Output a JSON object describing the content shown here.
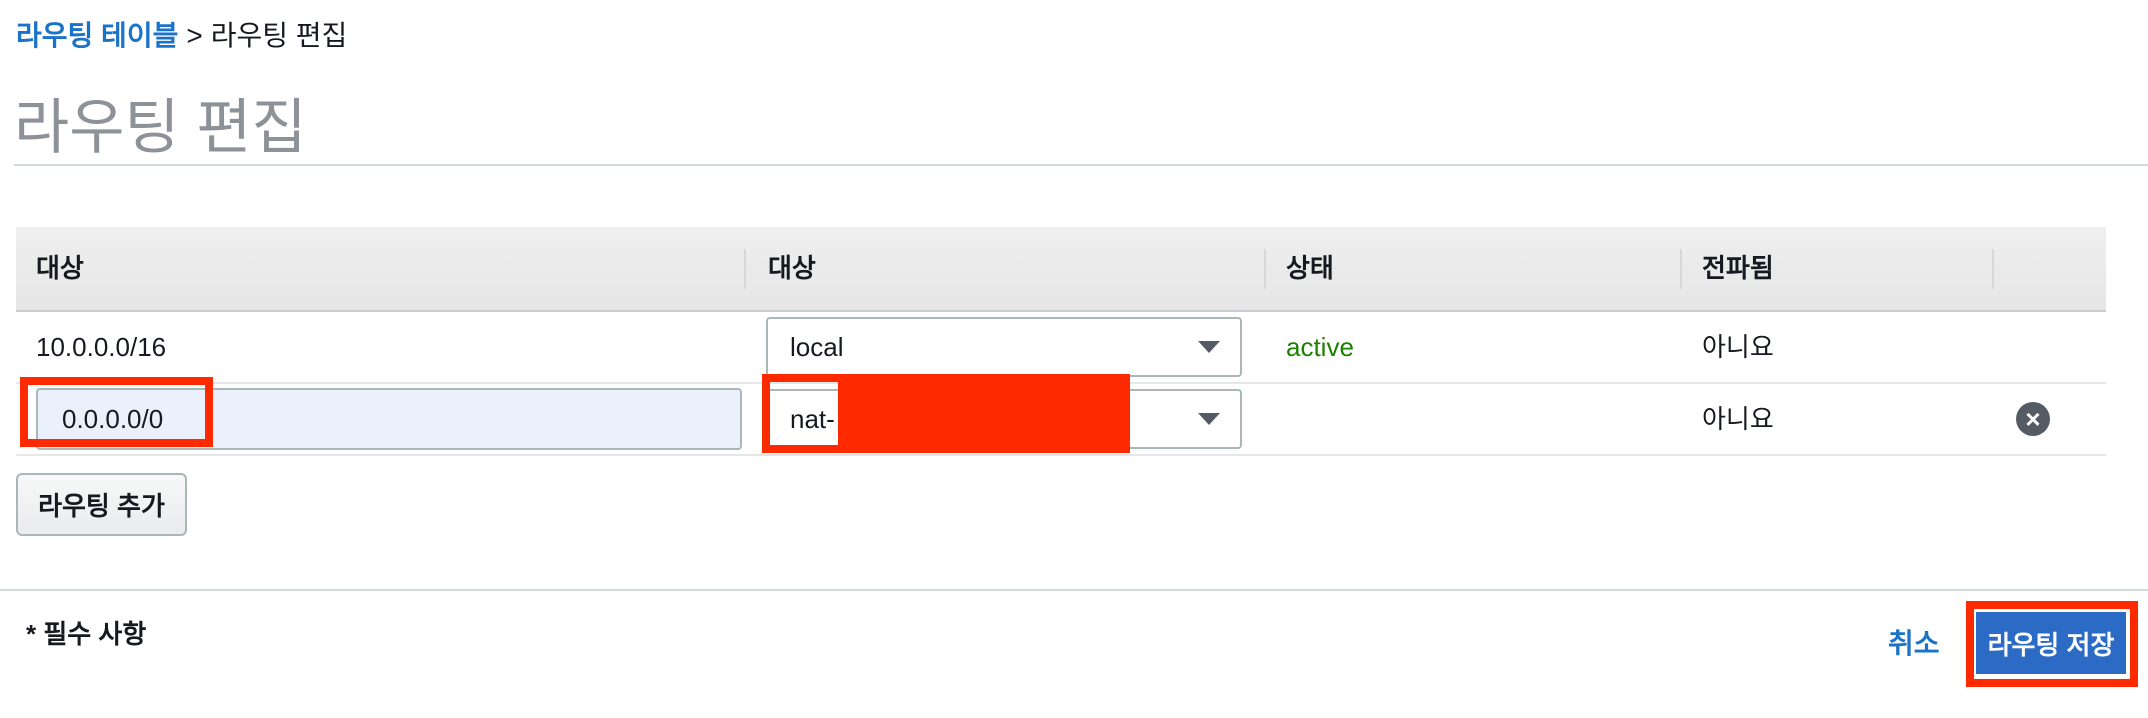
{
  "breadcrumb": {
    "parent_label": "라우팅 테이블",
    "separator": ">",
    "current_label": "라우팅 편집"
  },
  "page": {
    "title": "라우팅 편집"
  },
  "table": {
    "columns": [
      "대상",
      "대상",
      "상태",
      "전파됨"
    ],
    "rows": [
      {
        "destination": "10.0.0.0/16",
        "target": "local",
        "status": "active",
        "propagated": "아니요"
      },
      {
        "destination": "0.0.0.0/0",
        "target": "nat-",
        "status": "",
        "propagated": "아니요"
      }
    ]
  },
  "actions": {
    "add_route_label": "라우팅 추가",
    "required_note": "* 필수 사항",
    "cancel_label": "취소",
    "save_label": "라우팅 저장"
  },
  "icons": {
    "remove_row": "close-circle-icon",
    "dropdown": "caret-down-icon"
  },
  "colors": {
    "link": "#1a73c8",
    "active_status": "#1d8102",
    "highlight": "#ff2a00",
    "primary_button": "#2b6bc6"
  }
}
